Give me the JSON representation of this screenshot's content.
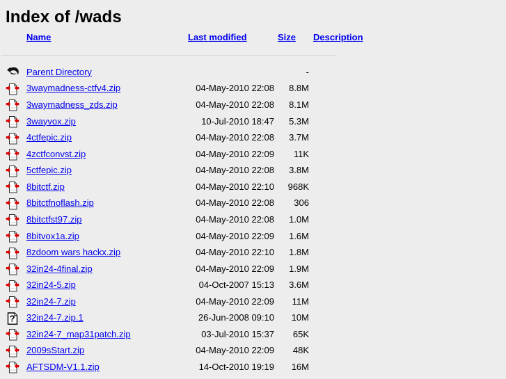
{
  "page": {
    "title": "Index of /wads"
  },
  "table": {
    "headers": [
      {
        "key": "name",
        "label": "Name",
        "icon": ""
      },
      {
        "key": "last_modified",
        "label": "Last modified"
      },
      {
        "key": "size",
        "label": "Size"
      },
      {
        "key": "description",
        "label": "Description"
      }
    ],
    "parent": {
      "icon": "back-arrow-icon",
      "name": "Parent Directory",
      "last_modified": "",
      "size": "-",
      "description": ""
    },
    "rows": [
      {
        "icon": "compressed-file-icon",
        "name": "3waymadness-ctfv4.zip",
        "last_modified": "04-May-2010 22:08",
        "size": "8.8M",
        "description": ""
      },
      {
        "icon": "compressed-file-icon",
        "name": "3waymadness_zds.zip",
        "last_modified": "04-May-2010 22:08",
        "size": "8.1M",
        "description": ""
      },
      {
        "icon": "compressed-file-icon",
        "name": "3wayvox.zip",
        "last_modified": "10-Jul-2010 18:47",
        "size": "5.3M",
        "description": ""
      },
      {
        "icon": "compressed-file-icon",
        "name": "4ctfepic.zip",
        "last_modified": "04-May-2010 22:08",
        "size": "3.7M",
        "description": ""
      },
      {
        "icon": "compressed-file-icon",
        "name": "4zctfconvst.zip",
        "last_modified": "04-May-2010 22:09",
        "size": "11K",
        "description": ""
      },
      {
        "icon": "compressed-file-icon",
        "name": "5ctfepic.zip",
        "last_modified": "04-May-2010 22:08",
        "size": "3.8M",
        "description": ""
      },
      {
        "icon": "compressed-file-icon",
        "name": "8bitctf.zip",
        "last_modified": "04-May-2010 22:10",
        "size": "968K",
        "description": ""
      },
      {
        "icon": "compressed-file-icon",
        "name": "8bitctfnoflash.zip",
        "last_modified": "04-May-2010 22:08",
        "size": "306",
        "description": ""
      },
      {
        "icon": "compressed-file-icon",
        "name": "8bitctfst97.zip",
        "last_modified": "04-May-2010 22:08",
        "size": "1.0M",
        "description": ""
      },
      {
        "icon": "compressed-file-icon",
        "name": "8bitvox1a.zip",
        "last_modified": "04-May-2010 22:09",
        "size": "1.6M",
        "description": ""
      },
      {
        "icon": "compressed-file-icon",
        "name": "8zdoom wars hackx.zip",
        "last_modified": "04-May-2010 22:10",
        "size": "1.8M",
        "description": ""
      },
      {
        "icon": "compressed-file-icon",
        "name": "32in24-4final.zip",
        "last_modified": "04-May-2010 22:09",
        "size": "1.9M",
        "description": ""
      },
      {
        "icon": "compressed-file-icon",
        "name": "32in24-5.zip",
        "last_modified": "04-Oct-2007 15:13",
        "size": "3.6M",
        "description": ""
      },
      {
        "icon": "compressed-file-icon",
        "name": "32in24-7.zip",
        "last_modified": "04-May-2010 22:09",
        "size": "11M",
        "description": ""
      },
      {
        "icon": "unknown-file-icon",
        "name": "32in24-7.zip.1",
        "last_modified": "26-Jun-2008 09:10",
        "size": "10M",
        "description": ""
      },
      {
        "icon": "compressed-file-icon",
        "name": "32in24-7_map31patch.zip",
        "last_modified": "03-Jul-2010 15:37",
        "size": "65K",
        "description": ""
      },
      {
        "icon": "compressed-file-icon",
        "name": "2009sStart.zip",
        "last_modified": "04-May-2010 22:09",
        "size": "48K",
        "description": ""
      },
      {
        "icon": "compressed-file-icon",
        "name": "AFTSDM-V1.1.zip",
        "last_modified": "14-Oct-2010 19:19",
        "size": "16M",
        "description": ""
      }
    ]
  },
  "colors": {
    "background": "#ededed",
    "link": "#0000ee",
    "text": "#000000",
    "rule": "#b9b9b9",
    "icon_red": "#dd0000"
  }
}
